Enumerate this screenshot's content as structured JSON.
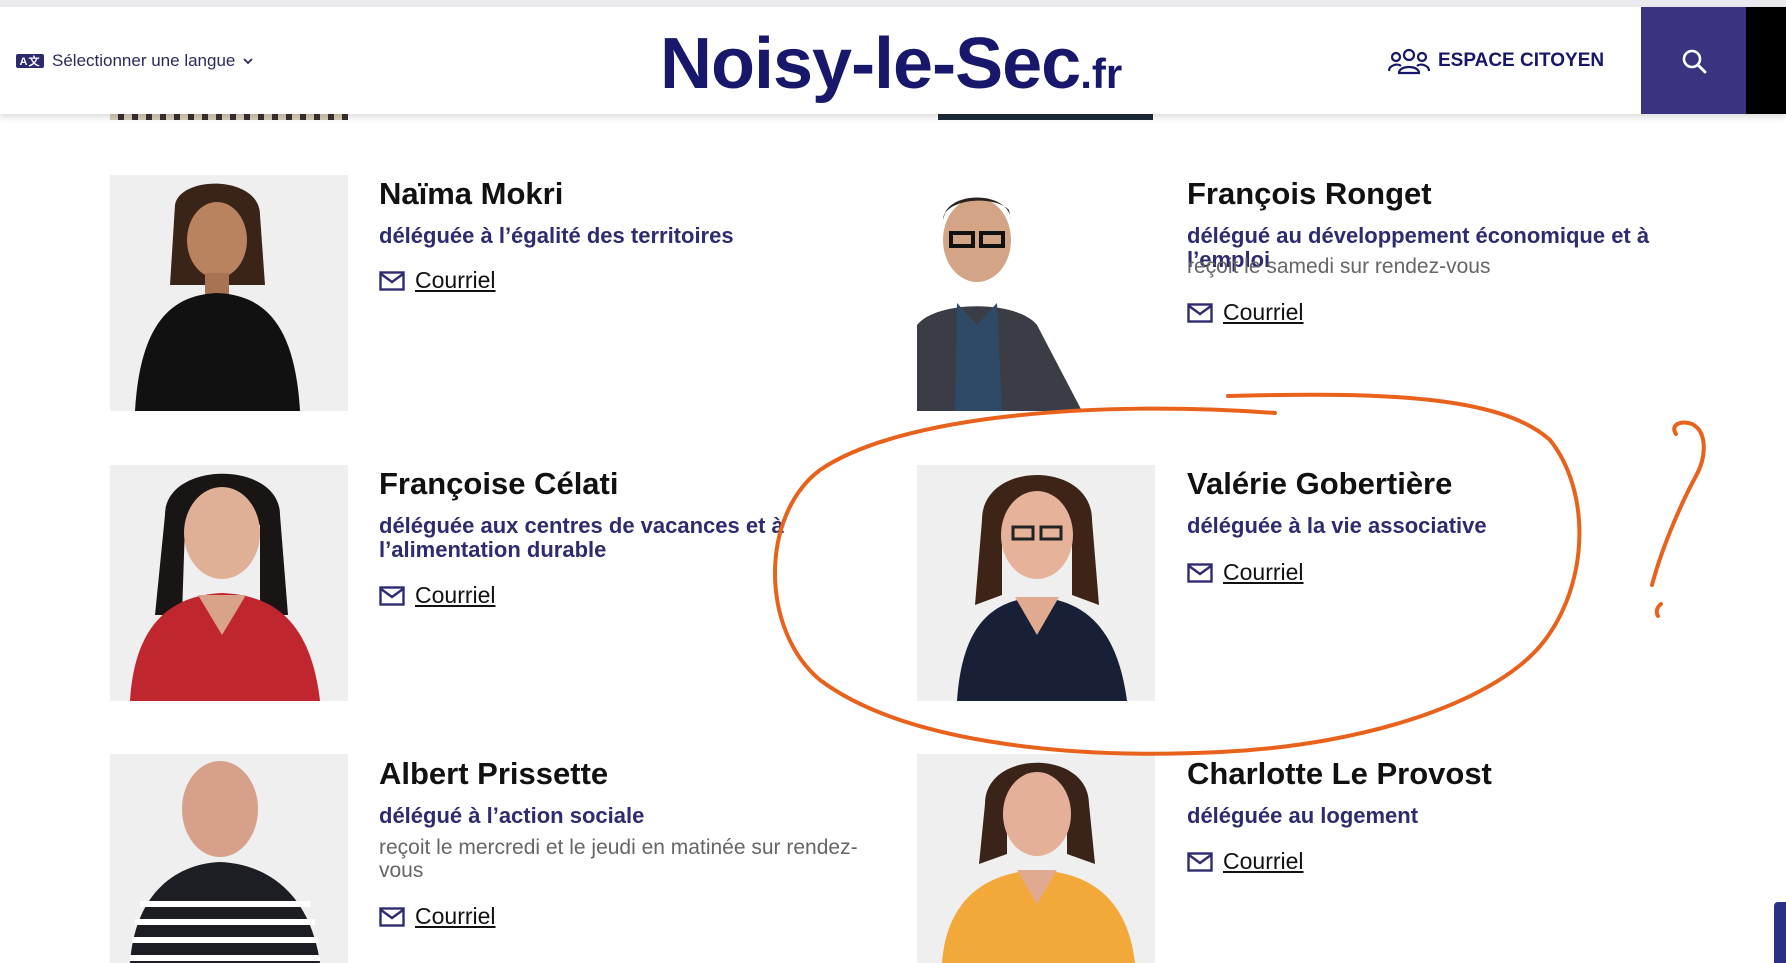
{
  "header": {
    "language_selector": "Sélectionner une langue",
    "logo_main": "Noisy-le-Sec",
    "logo_tld": ".fr",
    "espace_citoyen": "ESPACE CITOYEN"
  },
  "people": [
    {
      "name": "Naïma Mokri",
      "role": "déléguée à l’égalité des territoires",
      "note": "",
      "contact": "Courriel"
    },
    {
      "name": "François Ronget",
      "role": "délégué au développement économique et à l’emploi",
      "note": "reçoit le samedi sur rendez-vous",
      "contact": "Courriel"
    },
    {
      "name": "Françoise Célati",
      "role": "déléguée aux centres de vacances et à l’alimentation durable",
      "note": "",
      "contact": "Courriel"
    },
    {
      "name": "Valérie Gobertière",
      "role": "déléguée à la vie associative",
      "note": "",
      "contact": "Courriel"
    },
    {
      "name": "Albert Prissette",
      "role": "délégué à l’action sociale",
      "note": "reçoit le mercredi et le jeudi en matinée sur rendez-vous",
      "contact": "Courriel"
    },
    {
      "name": "Charlotte Le Provost",
      "role": "déléguée au logement",
      "note": "",
      "contact": "Courriel"
    }
  ],
  "annotation": {
    "color": "#e8621c",
    "mark": "circle-and-question-mark"
  },
  "colors": {
    "brand": "#17176b",
    "search_bg": "#3a3380",
    "role_text": "#2e2c6f"
  },
  "icons": [
    "translate-icon",
    "chevron-down-icon",
    "people-group-icon",
    "search-icon",
    "mail-icon"
  ]
}
